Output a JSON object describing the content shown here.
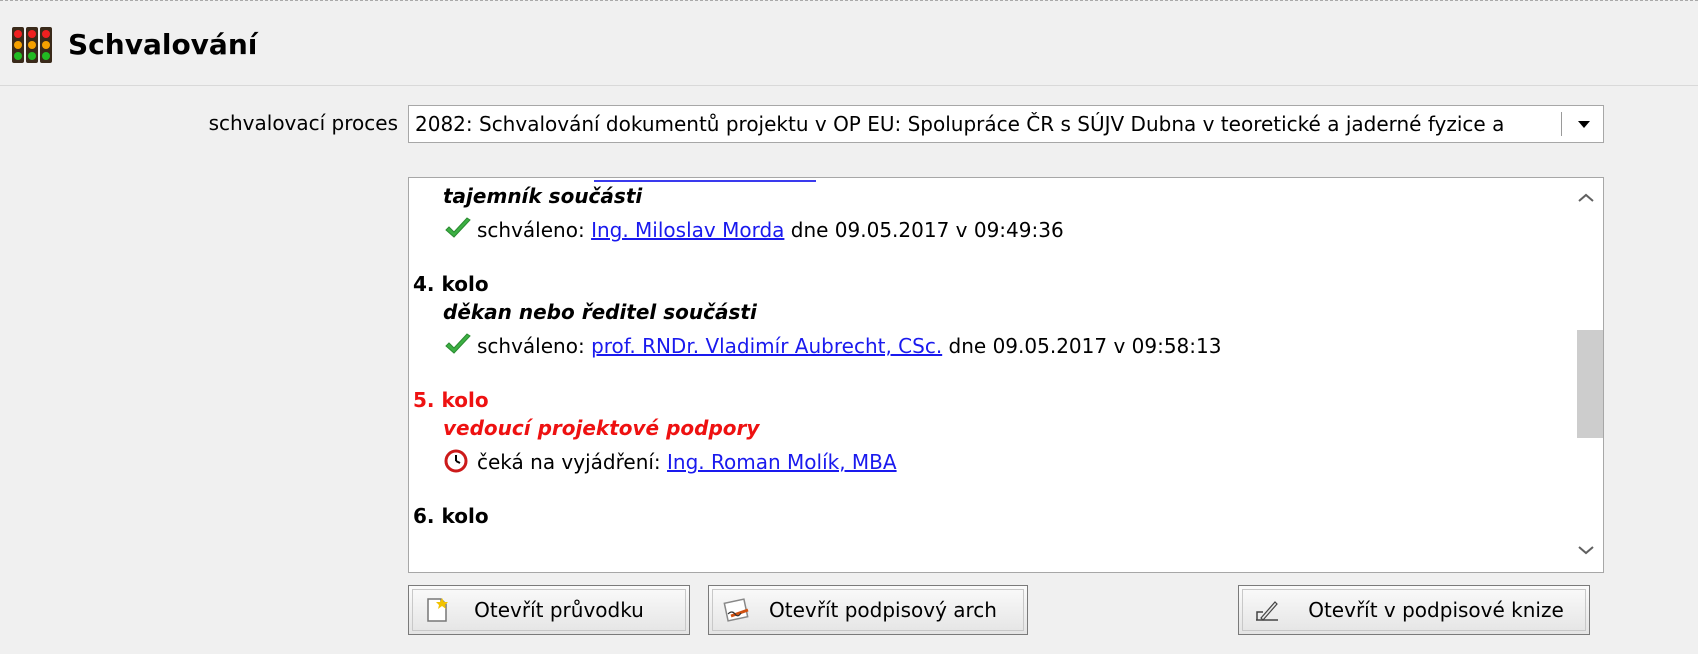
{
  "header": {
    "title": "Schvalování",
    "icon": "traffic-light-icon"
  },
  "process": {
    "label": "schvalovací proces",
    "selected": "2082: Schvalování dokumentů projektu v OP EU: Spolupráce ČR s SÚJV Dubna v teoretické a jaderné fyzice a"
  },
  "rounds": [
    {
      "role": "tajemník součásti",
      "status_icon": "check-icon",
      "status_text": "schváleno:",
      "person": "Ing. Miloslav Morda",
      "date_text": "dne 09.05.2017 v 09:49:36"
    },
    {
      "round": "4. kolo",
      "role": "děkan nebo ředitel součásti",
      "status_icon": "check-icon",
      "status_text": "schváleno:",
      "person": "prof. RNDr. Vladimír Aubrecht, CSc.",
      "date_text": "dne 09.05.2017 v 09:58:13"
    },
    {
      "round": "5. kolo",
      "role": "vedoucí projektové podpory",
      "status_icon": "clock-icon",
      "status_text": "čeká na vyjádření:",
      "person": "Ing. Roman Molík, MBA",
      "current": true,
      "current_color": "#ee1111"
    },
    {
      "round": "6. kolo"
    }
  ],
  "buttons": {
    "open_cover": "Otevřít průvodku",
    "open_sign_sheet": "Otevřít podpisový arch",
    "open_sign_book": "Otevřít v podpisové knize"
  },
  "colors": {
    "link": "#1a1aee",
    "current_round": "#ee1111",
    "check": "#3cb043"
  }
}
